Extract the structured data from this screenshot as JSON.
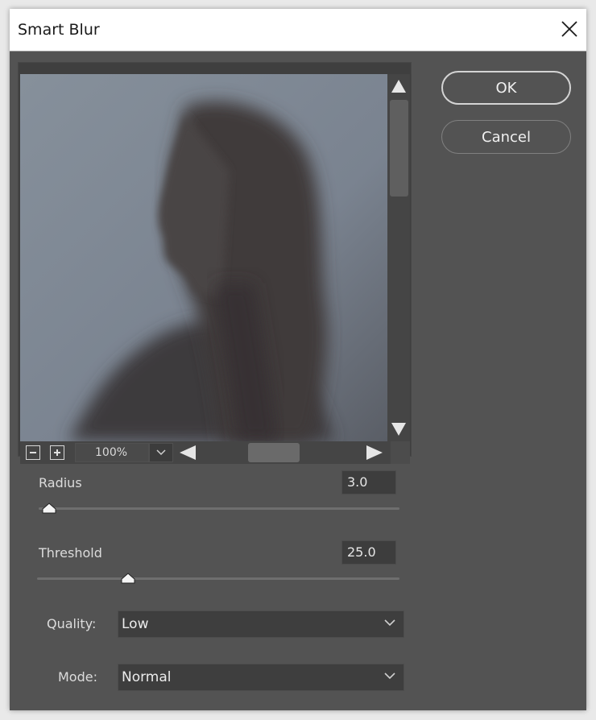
{
  "window": {
    "title": "Smart Blur",
    "close_icon": "close-icon"
  },
  "preview": {
    "description": "blurred profile portrait of a person with long hair against a grey-blue background",
    "zoom_level": "100%",
    "zoom_out_icon": "minus-box-icon",
    "zoom_in_icon": "plus-box-icon",
    "zoom_dropdown_icon": "chevron-down-icon",
    "scroll_up_icon": "triangle-up-icon",
    "scroll_down_icon": "triangle-down-icon",
    "scroll_left_icon": "triangle-left-icon",
    "scroll_right_icon": "triangle-right-icon"
  },
  "buttons": {
    "ok_label": "OK",
    "cancel_label": "Cancel"
  },
  "radius": {
    "label": "Radius",
    "value": "3.0",
    "slider_fraction": 0.03
  },
  "threshold": {
    "label": "Threshold",
    "value": "25.0",
    "slider_fraction": 0.25
  },
  "quality": {
    "label": "Quality:",
    "selected": "Low"
  },
  "mode": {
    "label": "Mode:",
    "selected": "Normal"
  },
  "colors": {
    "dialog_bg": "#535353",
    "titlebar_bg": "#ffffff",
    "preview_bg": "#7f8792"
  }
}
